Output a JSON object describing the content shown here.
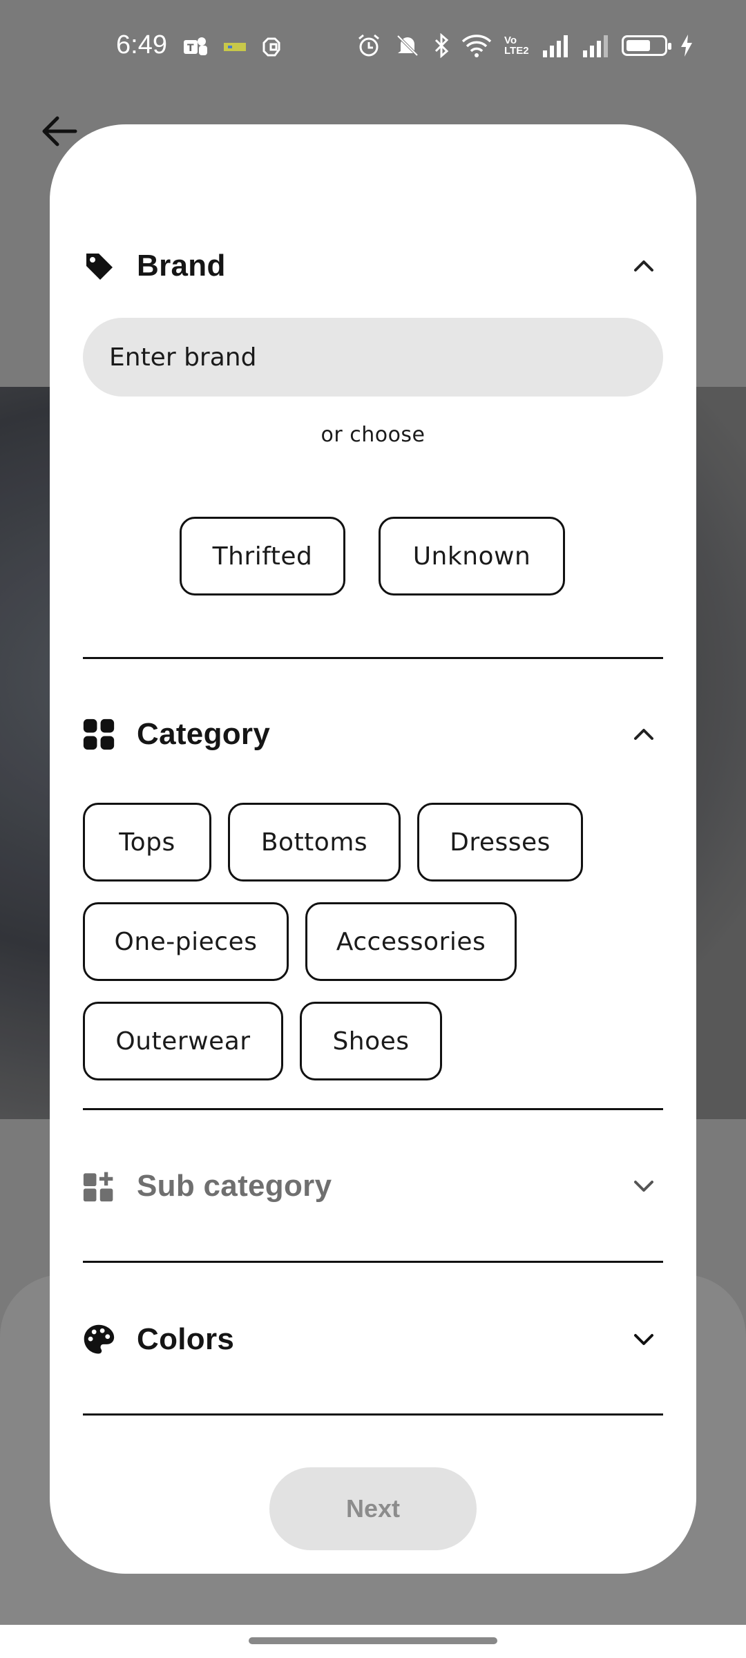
{
  "status_bar": {
    "time": "6:49",
    "left_icons": [
      "teams-icon",
      "pixel-game-icon",
      "copilot-icon"
    ],
    "right_icons": [
      "alarm-icon",
      "mute-icon",
      "bluetooth-icon",
      "wifi-icon",
      "volte-icon",
      "signal-icon",
      "signal-icon-2",
      "battery-icon",
      "charging-icon"
    ],
    "volte_label": "Vo LTE2"
  },
  "nav": {
    "back_icon": "arrow-left-icon"
  },
  "brand": {
    "title": "Brand",
    "icon": "tag-icon",
    "expanded": true,
    "input_placeholder": "Enter brand",
    "or_choose": "or choose",
    "options": [
      "Thrifted",
      "Unknown"
    ]
  },
  "category": {
    "title": "Category",
    "icon": "grid-icon",
    "expanded": true,
    "options": [
      "Tops",
      "Bottoms",
      "Dresses",
      "One-pieces",
      "Accessories",
      "Outerwear",
      "Shoes"
    ]
  },
  "sub_category": {
    "title": "Sub category",
    "icon": "widgets-add-icon",
    "expanded": false,
    "disabled": true
  },
  "colors": {
    "title": "Colors",
    "icon": "palette-icon",
    "expanded": false
  },
  "next_button": {
    "label": "Next",
    "enabled": false
  },
  "theme": {
    "card": "#ffffff",
    "input_bg": "#e6e6e6",
    "text": "#151515",
    "muted": "#6f6f6f",
    "disabled_btn": "#e2e2e2"
  }
}
